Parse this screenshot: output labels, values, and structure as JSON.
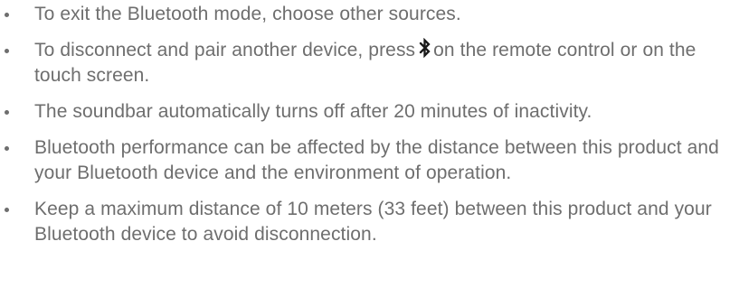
{
  "notes": [
    {
      "text": "To exit the Bluetooth mode, choose other sources."
    },
    {
      "text_before": "To disconnect and pair another device, press",
      "icon": "bluetooth-icon",
      "text_after": "on the remote control or on the touch screen."
    },
    {
      "text": "The soundbar automatically turns off after 20 minutes of inactivity."
    },
    {
      "text": "Bluetooth performance can be affected by the distance between this product and your Bluetooth device and the environment of operation."
    },
    {
      "text": "Keep a maximum distance of 10 meters (33 feet) between this product and your Bluetooth device to avoid disconnection."
    }
  ],
  "colors": {
    "text": "#6e6e6e",
    "background": "#ffffff"
  }
}
